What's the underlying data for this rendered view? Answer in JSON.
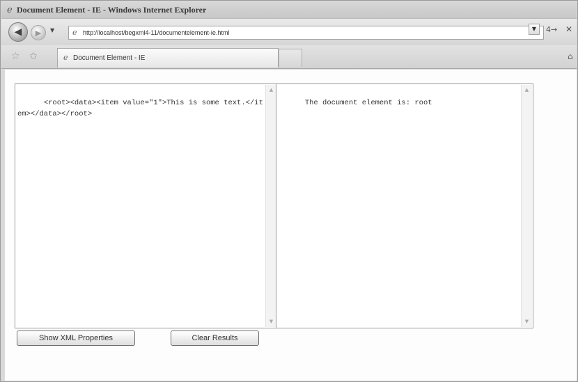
{
  "window": {
    "title": "Document Element - IE - Windows Internet Explorer"
  },
  "navigation": {
    "address_url": "http://localhost/begxml4-11/documentelement-ie.html",
    "back_icon": "back-arrow-icon",
    "forward_icon": "forward-arrow-icon",
    "refresh_label": "4→",
    "stop_label": "✕"
  },
  "tabs": {
    "active_tab_label": "Document Element - IE"
  },
  "page": {
    "xml_input_text": "<root><data><item value=\"1\">This is some text.</item></data></root>",
    "result_text": "The document element is: root",
    "buttons": {
      "show_xml_properties": "Show XML Properties",
      "clear_results": "Clear Results"
    }
  }
}
